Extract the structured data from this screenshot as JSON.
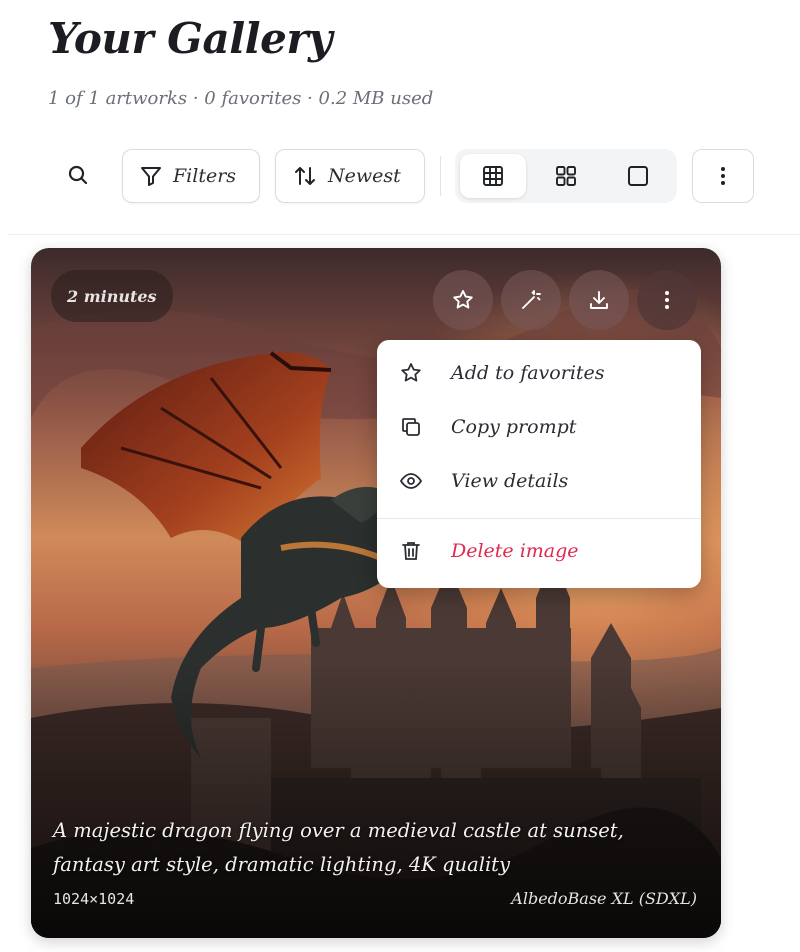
{
  "header": {
    "title": "Your Gallery",
    "subtitle": "1 of 1 artworks · 0 favorites · 0.2 MB used"
  },
  "toolbar": {
    "search_icon": "search-icon",
    "filters_label": "Filters",
    "sort_label": "Newest",
    "view_modes": [
      "grid-dense-icon",
      "grid-icon",
      "single-icon"
    ],
    "active_view": "grid-dense"
  },
  "card": {
    "time_badge": "2 minutes",
    "actions": [
      "star-icon",
      "magic-wand-icon",
      "download-icon",
      "more-vertical-icon"
    ],
    "caption": "A majestic dragon flying over a medieval castle at sunset, fantasy art style, dramatic lighting, 4K quality",
    "dimensions": "1024×1024",
    "model": "AlbedoBase XL (SDXL)"
  },
  "menu": {
    "items": [
      {
        "label": "Add to favorites",
        "icon": "star-icon"
      },
      {
        "label": "Copy prompt",
        "icon": "copy-icon"
      },
      {
        "label": "View details",
        "icon": "eye-icon"
      },
      {
        "label": "Delete image",
        "icon": "trash-icon"
      }
    ]
  },
  "colors": {
    "danger": "#e0294f",
    "card_shadow": "#000000"
  }
}
